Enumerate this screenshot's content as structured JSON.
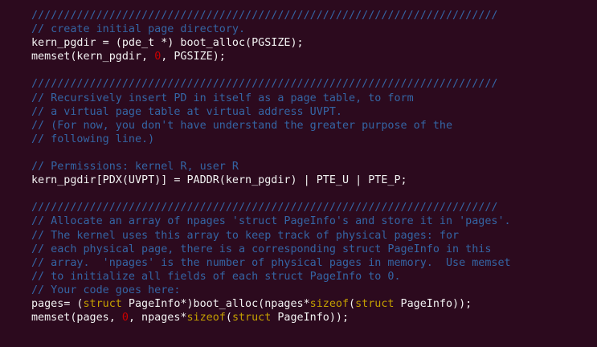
{
  "editor": {
    "lines": [
      {
        "segments": [
          {
            "t": "////////////////////////////////////////////////////////////////////////",
            "c": "cm"
          }
        ]
      },
      {
        "segments": [
          {
            "t": "// create initial page directory.",
            "c": "cm"
          }
        ]
      },
      {
        "segments": [
          {
            "t": "kern_pgdir = (pde_t *) boot_alloc(PGSIZE);",
            "c": "tx"
          }
        ]
      },
      {
        "segments": [
          {
            "t": "memset(kern_pgdir, ",
            "c": "tx"
          },
          {
            "t": "0",
            "c": "num"
          },
          {
            "t": ", PGSIZE);",
            "c": "tx"
          }
        ]
      },
      {
        "segments": []
      },
      {
        "segments": [
          {
            "t": "////////////////////////////////////////////////////////////////////////",
            "c": "cm"
          }
        ]
      },
      {
        "segments": [
          {
            "t": "// Recursively insert PD in itself as a page table, to form",
            "c": "cm"
          }
        ]
      },
      {
        "segments": [
          {
            "t": "// a virtual page table at virtual address UVPT.",
            "c": "cm"
          }
        ]
      },
      {
        "segments": [
          {
            "t": "// (For now, you don't have understand the greater purpose of the",
            "c": "cm"
          }
        ]
      },
      {
        "segments": [
          {
            "t": "// following line.)",
            "c": "cm"
          }
        ]
      },
      {
        "segments": []
      },
      {
        "segments": [
          {
            "t": "// Permissions: kernel R, user R",
            "c": "cm"
          }
        ]
      },
      {
        "segments": [
          {
            "t": "kern_pgdir[PDX(UVPT)] = PADDR(kern_pgdir) | PTE_U | PTE_P;",
            "c": "tx"
          }
        ]
      },
      {
        "segments": []
      },
      {
        "segments": [
          {
            "t": "////////////////////////////////////////////////////////////////////////",
            "c": "cm"
          }
        ]
      },
      {
        "segments": [
          {
            "t": "// Allocate an array of npages 'struct PageInfo's and store it in 'pages'.",
            "c": "cm"
          }
        ]
      },
      {
        "segments": [
          {
            "t": "// The kernel uses this array to keep track of physical pages: for",
            "c": "cm"
          }
        ]
      },
      {
        "segments": [
          {
            "t": "// each physical page, there is a corresponding struct PageInfo in this",
            "c": "cm"
          }
        ]
      },
      {
        "segments": [
          {
            "t": "// array.  'npages' is the number of physical pages in memory.  Use memset",
            "c": "cm"
          }
        ]
      },
      {
        "segments": [
          {
            "t": "// to initialize all fields of each struct PageInfo to 0.",
            "c": "cm"
          }
        ]
      },
      {
        "segments": [
          {
            "t": "// Your code goes here:",
            "c": "cm"
          }
        ]
      },
      {
        "segments": [
          {
            "t": "pages= (",
            "c": "tx"
          },
          {
            "t": "struct",
            "c": "kw"
          },
          {
            "t": " PageInfo*)boot_alloc(npages*",
            "c": "tx"
          },
          {
            "t": "sizeof",
            "c": "kw"
          },
          {
            "t": "(",
            "c": "tx"
          },
          {
            "t": "struct",
            "c": "kw"
          },
          {
            "t": " PageInfo));",
            "c": "tx"
          }
        ]
      },
      {
        "segments": [
          {
            "t": "memset(pages, ",
            "c": "tx"
          },
          {
            "t": "0",
            "c": "num"
          },
          {
            "t": ", npages*",
            "c": "tx"
          },
          {
            "t": "sizeof",
            "c": "kw"
          },
          {
            "t": "(",
            "c": "tx"
          },
          {
            "t": "struct",
            "c": "kw"
          },
          {
            "t": " PageInfo));",
            "c": "tx"
          }
        ]
      }
    ]
  }
}
